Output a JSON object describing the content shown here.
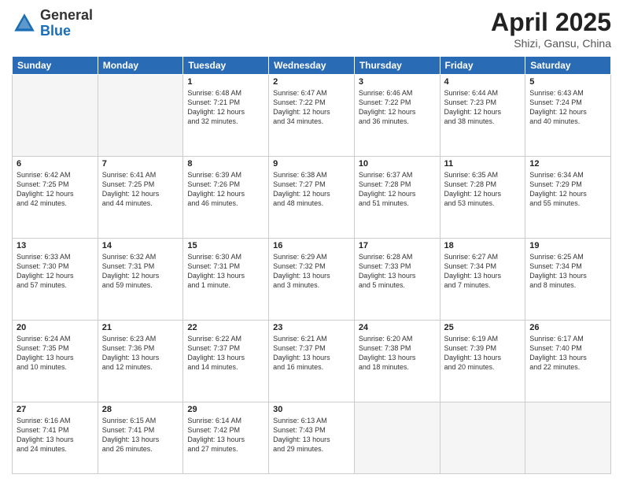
{
  "logo": {
    "general": "General",
    "blue": "Blue"
  },
  "title": {
    "month": "April 2025",
    "location": "Shizi, Gansu, China"
  },
  "days_header": [
    "Sunday",
    "Monday",
    "Tuesday",
    "Wednesday",
    "Thursday",
    "Friday",
    "Saturday"
  ],
  "weeks": [
    [
      {
        "day": "",
        "info": ""
      },
      {
        "day": "",
        "info": ""
      },
      {
        "day": "1",
        "info": "Sunrise: 6:48 AM\nSunset: 7:21 PM\nDaylight: 12 hours\nand 32 minutes."
      },
      {
        "day": "2",
        "info": "Sunrise: 6:47 AM\nSunset: 7:22 PM\nDaylight: 12 hours\nand 34 minutes."
      },
      {
        "day": "3",
        "info": "Sunrise: 6:46 AM\nSunset: 7:22 PM\nDaylight: 12 hours\nand 36 minutes."
      },
      {
        "day": "4",
        "info": "Sunrise: 6:44 AM\nSunset: 7:23 PM\nDaylight: 12 hours\nand 38 minutes."
      },
      {
        "day": "5",
        "info": "Sunrise: 6:43 AM\nSunset: 7:24 PM\nDaylight: 12 hours\nand 40 minutes."
      }
    ],
    [
      {
        "day": "6",
        "info": "Sunrise: 6:42 AM\nSunset: 7:25 PM\nDaylight: 12 hours\nand 42 minutes."
      },
      {
        "day": "7",
        "info": "Sunrise: 6:41 AM\nSunset: 7:25 PM\nDaylight: 12 hours\nand 44 minutes."
      },
      {
        "day": "8",
        "info": "Sunrise: 6:39 AM\nSunset: 7:26 PM\nDaylight: 12 hours\nand 46 minutes."
      },
      {
        "day": "9",
        "info": "Sunrise: 6:38 AM\nSunset: 7:27 PM\nDaylight: 12 hours\nand 48 minutes."
      },
      {
        "day": "10",
        "info": "Sunrise: 6:37 AM\nSunset: 7:28 PM\nDaylight: 12 hours\nand 51 minutes."
      },
      {
        "day": "11",
        "info": "Sunrise: 6:35 AM\nSunset: 7:28 PM\nDaylight: 12 hours\nand 53 minutes."
      },
      {
        "day": "12",
        "info": "Sunrise: 6:34 AM\nSunset: 7:29 PM\nDaylight: 12 hours\nand 55 minutes."
      }
    ],
    [
      {
        "day": "13",
        "info": "Sunrise: 6:33 AM\nSunset: 7:30 PM\nDaylight: 12 hours\nand 57 minutes."
      },
      {
        "day": "14",
        "info": "Sunrise: 6:32 AM\nSunset: 7:31 PM\nDaylight: 12 hours\nand 59 minutes."
      },
      {
        "day": "15",
        "info": "Sunrise: 6:30 AM\nSunset: 7:31 PM\nDaylight: 13 hours\nand 1 minute."
      },
      {
        "day": "16",
        "info": "Sunrise: 6:29 AM\nSunset: 7:32 PM\nDaylight: 13 hours\nand 3 minutes."
      },
      {
        "day": "17",
        "info": "Sunrise: 6:28 AM\nSunset: 7:33 PM\nDaylight: 13 hours\nand 5 minutes."
      },
      {
        "day": "18",
        "info": "Sunrise: 6:27 AM\nSunset: 7:34 PM\nDaylight: 13 hours\nand 7 minutes."
      },
      {
        "day": "19",
        "info": "Sunrise: 6:25 AM\nSunset: 7:34 PM\nDaylight: 13 hours\nand 8 minutes."
      }
    ],
    [
      {
        "day": "20",
        "info": "Sunrise: 6:24 AM\nSunset: 7:35 PM\nDaylight: 13 hours\nand 10 minutes."
      },
      {
        "day": "21",
        "info": "Sunrise: 6:23 AM\nSunset: 7:36 PM\nDaylight: 13 hours\nand 12 minutes."
      },
      {
        "day": "22",
        "info": "Sunrise: 6:22 AM\nSunset: 7:37 PM\nDaylight: 13 hours\nand 14 minutes."
      },
      {
        "day": "23",
        "info": "Sunrise: 6:21 AM\nSunset: 7:37 PM\nDaylight: 13 hours\nand 16 minutes."
      },
      {
        "day": "24",
        "info": "Sunrise: 6:20 AM\nSunset: 7:38 PM\nDaylight: 13 hours\nand 18 minutes."
      },
      {
        "day": "25",
        "info": "Sunrise: 6:19 AM\nSunset: 7:39 PM\nDaylight: 13 hours\nand 20 minutes."
      },
      {
        "day": "26",
        "info": "Sunrise: 6:17 AM\nSunset: 7:40 PM\nDaylight: 13 hours\nand 22 minutes."
      }
    ],
    [
      {
        "day": "27",
        "info": "Sunrise: 6:16 AM\nSunset: 7:41 PM\nDaylight: 13 hours\nand 24 minutes."
      },
      {
        "day": "28",
        "info": "Sunrise: 6:15 AM\nSunset: 7:41 PM\nDaylight: 13 hours\nand 26 minutes."
      },
      {
        "day": "29",
        "info": "Sunrise: 6:14 AM\nSunset: 7:42 PM\nDaylight: 13 hours\nand 27 minutes."
      },
      {
        "day": "30",
        "info": "Sunrise: 6:13 AM\nSunset: 7:43 PM\nDaylight: 13 hours\nand 29 minutes."
      },
      {
        "day": "",
        "info": ""
      },
      {
        "day": "",
        "info": ""
      },
      {
        "day": "",
        "info": ""
      }
    ]
  ]
}
